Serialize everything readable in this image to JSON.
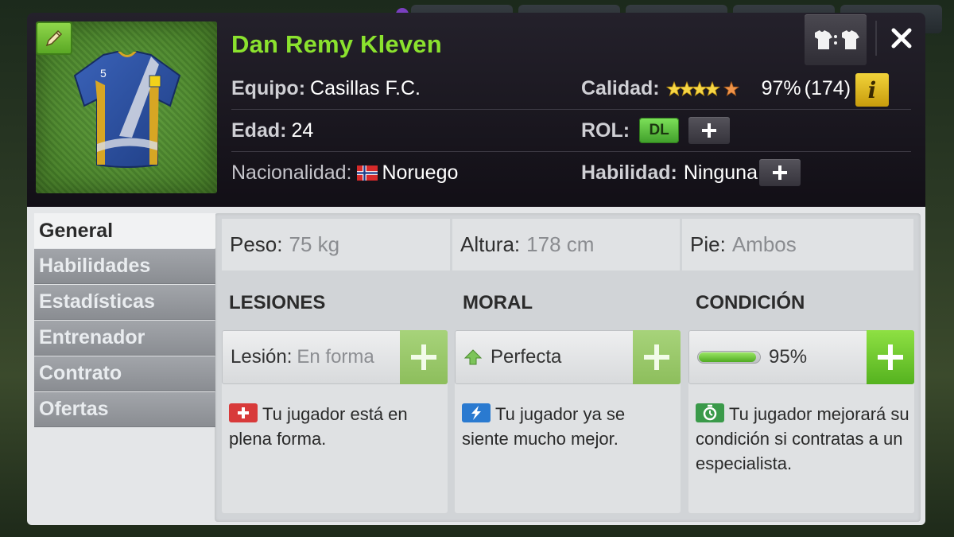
{
  "header": {
    "player_name": "Dan Remy Kleven",
    "team_label": "Equipo:",
    "team_value": "Casillas F.C.",
    "age_label": "Edad:",
    "age_value": "24",
    "nationality_label": "Nacionalidad:",
    "nationality_value": "Noruego",
    "quality_label": "Calidad:",
    "quality_stars": 4.5,
    "quality_percent": "97%",
    "quality_points": "(174)",
    "info_label": "i",
    "role_label": "ROL:",
    "role_value": "DL",
    "skill_label": "Habilidad:",
    "skill_value": "Ninguna",
    "shirt_number": "5",
    "kit_icon_text": "👕:👕",
    "icons": {
      "edit": "pencil-icon",
      "kit": "kit-compare-icon",
      "close": "close-icon",
      "flag": "norway-flag-icon",
      "info": "info-icon",
      "add": "plus-icon"
    }
  },
  "tabs": [
    {
      "label": "General",
      "active": true
    },
    {
      "label": "Habilidades",
      "active": false
    },
    {
      "label": "Estadísticas",
      "active": false
    },
    {
      "label": "Entrenador",
      "active": false
    },
    {
      "label": "Contrato",
      "active": false
    },
    {
      "label": "Ofertas",
      "active": false
    }
  ],
  "stats": {
    "weight_label": "Peso:",
    "weight_value": "75 kg",
    "height_label": "Altura:",
    "height_value": "178 cm",
    "foot_label": "Pie:",
    "foot_value": "Ambos"
  },
  "sections": {
    "injuries": {
      "title": "LESIONES",
      "field_label": "Lesión:",
      "field_value": "En forma",
      "description": "Tu jugador está en plena forma.",
      "icon": "medical-cross-icon"
    },
    "morale": {
      "title": "MORAL",
      "field_value": "Perfecta",
      "description": "Tu jugador ya se siente mucho mejor.",
      "icon": "lightning-icon",
      "trend_icon": "arrow-up-icon"
    },
    "condition": {
      "title": "CONDICIÓN",
      "field_value": "95%",
      "level": 0.95,
      "description": "Tu jugador mejorará su condición si contratas a un especialista.",
      "icon": "stopwatch-icon"
    }
  },
  "colors": {
    "name_green": "#8be22e",
    "accent_green": "#55b21f",
    "info_yellow": "#f1d33a",
    "header_bg": "#18151c"
  }
}
